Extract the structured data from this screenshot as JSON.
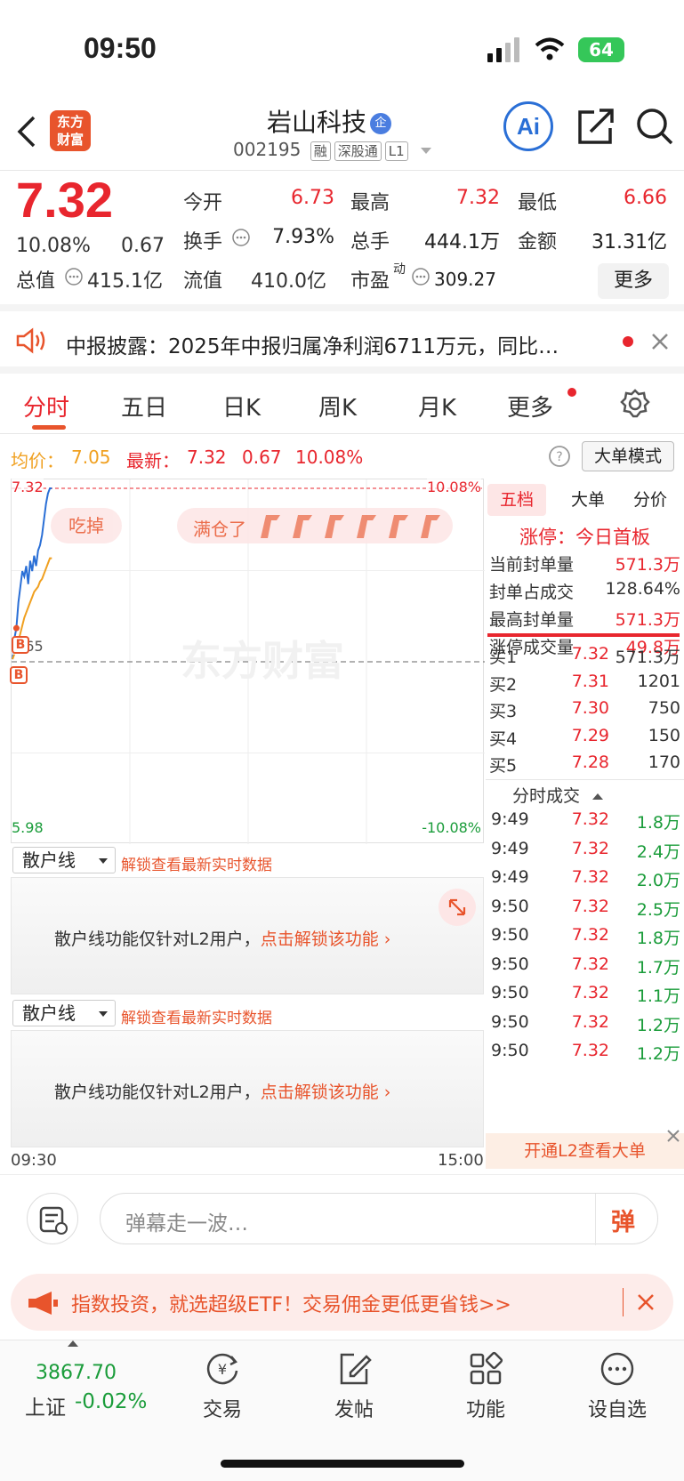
{
  "status_bar": {
    "time": "09:50",
    "battery": "64"
  },
  "header": {
    "logo_text_1": "东方",
    "logo_text_2": "财富",
    "stock_name": "岩山科技",
    "qi_badge": "企",
    "code": "002195",
    "tags": [
      "融",
      "深股通",
      "L1"
    ]
  },
  "quote": {
    "price": "7.32",
    "change_pct": "10.08%",
    "change": "0.67",
    "rows": [
      [
        {
          "label": "今开",
          "value": "6.73",
          "color": "red"
        },
        {
          "label": "最高",
          "value": "7.32",
          "color": "red"
        },
        {
          "label": "最低",
          "value": "6.66",
          "color": "red"
        }
      ],
      [
        {
          "label": "换手",
          "value": "7.93%",
          "color": "black"
        },
        {
          "label": "总手",
          "value": "444.1万",
          "color": "black"
        },
        {
          "label": "金额",
          "value": "31.31亿",
          "color": "black"
        }
      ]
    ],
    "total_value_label": "总值",
    "total_value": "415.1亿",
    "float_value_label": "流值",
    "float_value": "410.0亿",
    "pe_label": "市盈",
    "pe_super": "动",
    "pe_value": "309.27",
    "more_button": "更多"
  },
  "notice": {
    "text": "中报披露：2025年中报归属净利润6711万元，同比…"
  },
  "tabs": [
    "分时",
    "五日",
    "日K",
    "周K",
    "月K",
    "更多"
  ],
  "avg_line": {
    "avg_label": "均价：",
    "avg_value": "7.05",
    "latest_label": "最新：",
    "latest_value": "7.32",
    "latest_change": "0.67",
    "latest_pct": "10.08%",
    "mode_button": "大单模式"
  },
  "chart": {
    "top_left": "7.32",
    "top_right": "10.08%",
    "mid_left": "6.65",
    "bottom_left": "5.98",
    "bottom_right": "-10.08%",
    "bubble_1": "吃掉",
    "bubble_2": "满仓了",
    "watermark": "东方财富",
    "marker_b": "B",
    "time_start": "09:30",
    "time_end": "15:00"
  },
  "chart_data": {
    "type": "line",
    "x": [
      "09:30",
      "09:31",
      "09:32",
      "09:33",
      "09:34",
      "09:35",
      "09:36",
      "09:37",
      "09:38",
      "09:39",
      "09:40",
      "09:41",
      "09:42",
      "09:43",
      "09:44",
      "09:45",
      "09:46",
      "09:47",
      "09:48",
      "09:49",
      "09:50"
    ],
    "series": [
      {
        "values": [
          6.66,
          6.74,
          6.78,
          6.88,
          6.94,
          7.0,
          6.98,
          7.02,
          6.95,
          7.04,
          7.0,
          7.06,
          7.02,
          7.08,
          7.1,
          7.14,
          7.2,
          7.26,
          7.3,
          7.32,
          7.32
        ],
        "color": "#2a6fd6"
      },
      {
        "values": [
          6.66,
          6.68,
          6.7,
          6.73,
          6.76,
          6.79,
          6.82,
          6.84,
          6.86,
          6.88,
          6.9,
          6.92,
          6.93,
          6.94,
          6.96,
          6.97,
          6.99,
          7.01,
          7.03,
          7.05,
          7.05
        ],
        "color": "#f0a020"
      }
    ],
    "ylim": [
      5.98,
      7.32
    ],
    "xlim": [
      "09:30",
      "15:00"
    ],
    "grid": true
  },
  "side": {
    "tabs": [
      "五档",
      "大单",
      "分价"
    ],
    "limit_title": "涨停：今日首板",
    "stats": [
      {
        "label": "当前封单量",
        "value": "571.3万",
        "color": "red"
      },
      {
        "label": "封单占成交",
        "value": "128.64%",
        "color": "black"
      },
      {
        "label": "最高封单量",
        "value": "571.3万",
        "color": "red"
      },
      {
        "label": "涨停成交量",
        "value": "49.8万",
        "color": "red"
      }
    ],
    "bids": [
      {
        "label": "买1",
        "price": "7.32",
        "vol": "571.3万"
      },
      {
        "label": "买2",
        "price": "7.31",
        "vol": "1201"
      },
      {
        "label": "买3",
        "price": "7.30",
        "vol": "750"
      },
      {
        "label": "买4",
        "price": "7.29",
        "vol": "150"
      },
      {
        "label": "买5",
        "price": "7.28",
        "vol": "170"
      }
    ],
    "trades_title": "分时成交",
    "trades": [
      {
        "time": "9:49",
        "price": "7.32",
        "vol": "1.8万"
      },
      {
        "time": "9:49",
        "price": "7.32",
        "vol": "2.4万"
      },
      {
        "time": "9:49",
        "price": "7.32",
        "vol": "2.0万"
      },
      {
        "time": "9:50",
        "price": "7.32",
        "vol": "2.5万"
      },
      {
        "time": "9:50",
        "price": "7.32",
        "vol": "1.8万"
      },
      {
        "time": "9:50",
        "price": "7.32",
        "vol": "1.7万"
      },
      {
        "time": "9:50",
        "price": "7.32",
        "vol": "1.1万"
      },
      {
        "time": "9:50",
        "price": "7.32",
        "vol": "1.2万"
      },
      {
        "time": "9:50",
        "price": "7.32",
        "vol": "1.2万"
      }
    ],
    "l2_banner": "开通L2查看大单"
  },
  "indicators": {
    "select_label": "散户线",
    "unlock_text": "解锁查看最新实时数据",
    "body_text": "散户线功能仅针对L2用户，",
    "body_link": "点击解锁该功能"
  },
  "input_bar": {
    "placeholder": "弹幕走一波…",
    "danmu_button": "弹"
  },
  "ad": {
    "text": "指数投资，就选超级ETF！交易佣金更低更省钱>>"
  },
  "bottom_nav": {
    "index_value": "3867.70",
    "index_label": "上证",
    "index_change": "-0.02%",
    "items": [
      "交易",
      "发帖",
      "功能",
      "设自选"
    ]
  }
}
